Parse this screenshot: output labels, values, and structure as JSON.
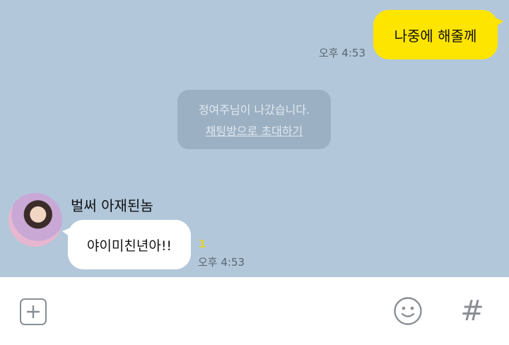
{
  "messages": {
    "outgoing": {
      "text": "나중에 해줄께",
      "time": "오후 4:53"
    },
    "system": {
      "text": "정여주님이 나갔습니다.",
      "link": "채팅방으로 초대하기"
    },
    "incoming": {
      "sender": "벌써 아재된놈",
      "text": "야이미친년아!!",
      "unread": "1",
      "time": "오후 4:53"
    }
  },
  "input_bar": {
    "icons": [
      "plus-icon",
      "emoticon-icon",
      "hash-icon"
    ],
    "hash_glyph": "#"
  },
  "colors": {
    "chat_bg": "#b2c7da",
    "outgoing_bubble": "#fee500",
    "incoming_bubble": "#ffffff",
    "unread": "#e5d22a",
    "icon_gray": "#8a8f94"
  }
}
